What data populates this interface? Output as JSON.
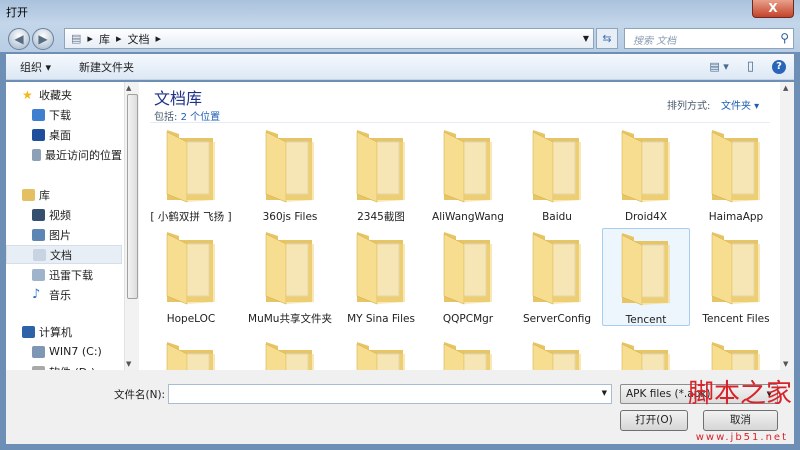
{
  "window": {
    "title": "打开",
    "close_glyph": "X"
  },
  "address": {
    "crumbs": [
      "库",
      "文档"
    ],
    "search_placeholder": "搜索 文档"
  },
  "toolbar": {
    "organize": "组织 ▾",
    "new_folder": "新建文件夹"
  },
  "sidebar": {
    "items": [
      {
        "label": "收藏夹",
        "icon": "star-icon",
        "color": "#f2b81c",
        "group": true
      },
      {
        "label": "下载",
        "icon": "downloads-icon",
        "color": "#3f7fd0"
      },
      {
        "label": "桌面",
        "icon": "desktop-icon",
        "color": "#1f4f9a"
      },
      {
        "label": "最近访问的位置",
        "icon": "recent-places-icon",
        "color": "#8ca0b8"
      },
      {
        "label": "库",
        "icon": "library-icon",
        "color": "#e5c062",
        "group": true
      },
      {
        "label": "视频",
        "icon": "video-icon",
        "color": "#35506e"
      },
      {
        "label": "图片",
        "icon": "pictures-icon",
        "color": "#5e86b4"
      },
      {
        "label": "文档",
        "icon": "documents-icon",
        "color": "#c8d4e2",
        "selected": true
      },
      {
        "label": "迅雷下载",
        "icon": "document-icon",
        "color": "#9fb4cc"
      },
      {
        "label": "音乐",
        "icon": "music-icon",
        "color": "#2a73c9"
      },
      {
        "label": "计算机",
        "icon": "computer-icon",
        "color": "#2d62a6",
        "group": true
      },
      {
        "label": "WIN7 (C:)",
        "icon": "drive-c-icon",
        "color": "#7e97b5"
      },
      {
        "label": "软件 (D:)",
        "icon": "drive-d-icon",
        "color": "#a9a9a9"
      }
    ]
  },
  "library": {
    "title": "文档库",
    "includes_label": "包括:",
    "includes_value": "2 个位置",
    "sort_label": "排列方式:",
    "sort_value": "文件夹 ▾"
  },
  "folders": [
    "[ 小鹤双拼 飞扬 ]",
    "360js Files",
    "2345截图",
    "AliWangWang",
    "Baidu",
    "Droid4X",
    "HaimaApp",
    "HopeLOC",
    "MuMu共享文件夹",
    "MY Sina Files",
    "QQPCMgr",
    "ServerConfig",
    "Tencent",
    "Tencent Files",
    "",
    "",
    "",
    "",
    "",
    "",
    ""
  ],
  "selected_folder": "Tencent",
  "bottom": {
    "filename_label": "文件名(N):",
    "filename_value": "",
    "filetype": "APK files (*.apk)",
    "open": "打开(O)",
    "cancel": "取消"
  },
  "watermark": {
    "text": "脚本之家",
    "url": "www.jb51.net"
  }
}
